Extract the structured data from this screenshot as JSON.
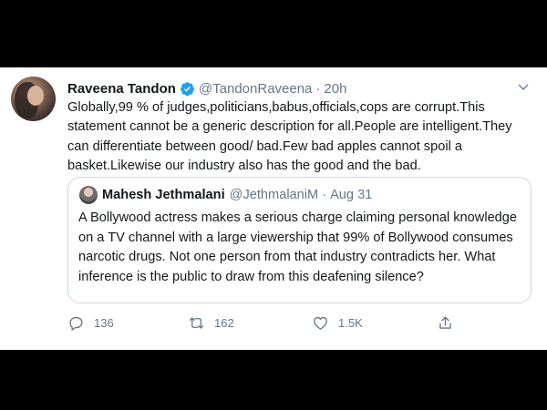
{
  "tweet": {
    "author_name": "Raveena Tandon",
    "handle": "@TandonRaveena",
    "separator": "·",
    "time": "20h",
    "text": "Globally,99 % of judges,politicians,babus,officials,cops are corrupt.This statement cannot be a generic description for all.People are intelligent.They can differentiate between good/ bad.Few bad apples cannot spoil a basket.Likewise our industry also has the good and the bad."
  },
  "quoted": {
    "author_name": "Mahesh Jethmalani",
    "handle": "@JethmalaniM",
    "separator": "·",
    "date": "Aug 31",
    "text": "A Bollywood actress makes a serious charge claiming personal knowledge on a TV channel with a large viewership that 99% of Bollywood consumes narcotic drugs. Not one person from that industry contradicts her. What inference is the public to draw from this deafening silence?"
  },
  "actions": {
    "replies": "136",
    "retweets": "162",
    "likes": "1.5K"
  },
  "colors": {
    "verified": "#1da1f2",
    "muted": "#657786",
    "border": "#ccd6dd"
  }
}
